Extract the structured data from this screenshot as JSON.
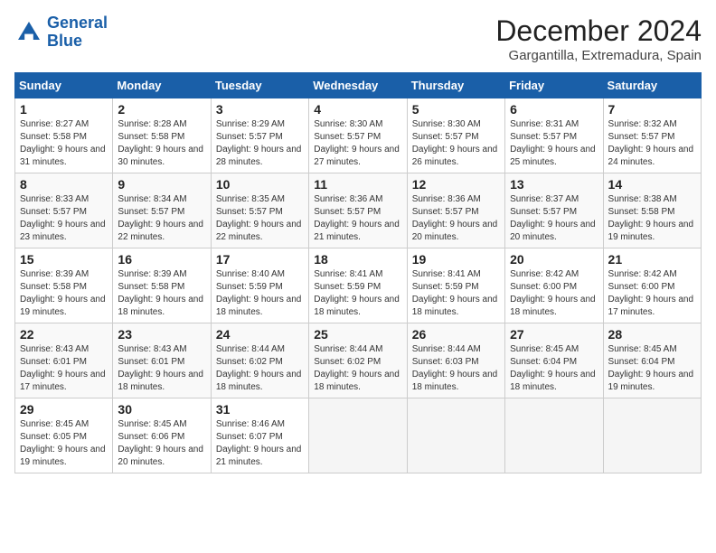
{
  "header": {
    "logo_line1": "General",
    "logo_line2": "Blue",
    "month_title": "December 2024",
    "location": "Gargantilla, Extremadura, Spain"
  },
  "days_of_week": [
    "Sunday",
    "Monday",
    "Tuesday",
    "Wednesday",
    "Thursday",
    "Friday",
    "Saturday"
  ],
  "weeks": [
    [
      {
        "day": "1",
        "sunrise": "Sunrise: 8:27 AM",
        "sunset": "Sunset: 5:58 PM",
        "daylight": "Daylight: 9 hours and 31 minutes."
      },
      {
        "day": "2",
        "sunrise": "Sunrise: 8:28 AM",
        "sunset": "Sunset: 5:58 PM",
        "daylight": "Daylight: 9 hours and 30 minutes."
      },
      {
        "day": "3",
        "sunrise": "Sunrise: 8:29 AM",
        "sunset": "Sunset: 5:57 PM",
        "daylight": "Daylight: 9 hours and 28 minutes."
      },
      {
        "day": "4",
        "sunrise": "Sunrise: 8:30 AM",
        "sunset": "Sunset: 5:57 PM",
        "daylight": "Daylight: 9 hours and 27 minutes."
      },
      {
        "day": "5",
        "sunrise": "Sunrise: 8:30 AM",
        "sunset": "Sunset: 5:57 PM",
        "daylight": "Daylight: 9 hours and 26 minutes."
      },
      {
        "day": "6",
        "sunrise": "Sunrise: 8:31 AM",
        "sunset": "Sunset: 5:57 PM",
        "daylight": "Daylight: 9 hours and 25 minutes."
      },
      {
        "day": "7",
        "sunrise": "Sunrise: 8:32 AM",
        "sunset": "Sunset: 5:57 PM",
        "daylight": "Daylight: 9 hours and 24 minutes."
      }
    ],
    [
      {
        "day": "8",
        "sunrise": "Sunrise: 8:33 AM",
        "sunset": "Sunset: 5:57 PM",
        "daylight": "Daylight: 9 hours and 23 minutes."
      },
      {
        "day": "9",
        "sunrise": "Sunrise: 8:34 AM",
        "sunset": "Sunset: 5:57 PM",
        "daylight": "Daylight: 9 hours and 22 minutes."
      },
      {
        "day": "10",
        "sunrise": "Sunrise: 8:35 AM",
        "sunset": "Sunset: 5:57 PM",
        "daylight": "Daylight: 9 hours and 22 minutes."
      },
      {
        "day": "11",
        "sunrise": "Sunrise: 8:36 AM",
        "sunset": "Sunset: 5:57 PM",
        "daylight": "Daylight: 9 hours and 21 minutes."
      },
      {
        "day": "12",
        "sunrise": "Sunrise: 8:36 AM",
        "sunset": "Sunset: 5:57 PM",
        "daylight": "Daylight: 9 hours and 20 minutes."
      },
      {
        "day": "13",
        "sunrise": "Sunrise: 8:37 AM",
        "sunset": "Sunset: 5:57 PM",
        "daylight": "Daylight: 9 hours and 20 minutes."
      },
      {
        "day": "14",
        "sunrise": "Sunrise: 8:38 AM",
        "sunset": "Sunset: 5:58 PM",
        "daylight": "Daylight: 9 hours and 19 minutes."
      }
    ],
    [
      {
        "day": "15",
        "sunrise": "Sunrise: 8:39 AM",
        "sunset": "Sunset: 5:58 PM",
        "daylight": "Daylight: 9 hours and 19 minutes."
      },
      {
        "day": "16",
        "sunrise": "Sunrise: 8:39 AM",
        "sunset": "Sunset: 5:58 PM",
        "daylight": "Daylight: 9 hours and 18 minutes."
      },
      {
        "day": "17",
        "sunrise": "Sunrise: 8:40 AM",
        "sunset": "Sunset: 5:59 PM",
        "daylight": "Daylight: 9 hours and 18 minutes."
      },
      {
        "day": "18",
        "sunrise": "Sunrise: 8:41 AM",
        "sunset": "Sunset: 5:59 PM",
        "daylight": "Daylight: 9 hours and 18 minutes."
      },
      {
        "day": "19",
        "sunrise": "Sunrise: 8:41 AM",
        "sunset": "Sunset: 5:59 PM",
        "daylight": "Daylight: 9 hours and 18 minutes."
      },
      {
        "day": "20",
        "sunrise": "Sunrise: 8:42 AM",
        "sunset": "Sunset: 6:00 PM",
        "daylight": "Daylight: 9 hours and 18 minutes."
      },
      {
        "day": "21",
        "sunrise": "Sunrise: 8:42 AM",
        "sunset": "Sunset: 6:00 PM",
        "daylight": "Daylight: 9 hours and 17 minutes."
      }
    ],
    [
      {
        "day": "22",
        "sunrise": "Sunrise: 8:43 AM",
        "sunset": "Sunset: 6:01 PM",
        "daylight": "Daylight: 9 hours and 17 minutes."
      },
      {
        "day": "23",
        "sunrise": "Sunrise: 8:43 AM",
        "sunset": "Sunset: 6:01 PM",
        "daylight": "Daylight: 9 hours and 18 minutes."
      },
      {
        "day": "24",
        "sunrise": "Sunrise: 8:44 AM",
        "sunset": "Sunset: 6:02 PM",
        "daylight": "Daylight: 9 hours and 18 minutes."
      },
      {
        "day": "25",
        "sunrise": "Sunrise: 8:44 AM",
        "sunset": "Sunset: 6:02 PM",
        "daylight": "Daylight: 9 hours and 18 minutes."
      },
      {
        "day": "26",
        "sunrise": "Sunrise: 8:44 AM",
        "sunset": "Sunset: 6:03 PM",
        "daylight": "Daylight: 9 hours and 18 minutes."
      },
      {
        "day": "27",
        "sunrise": "Sunrise: 8:45 AM",
        "sunset": "Sunset: 6:04 PM",
        "daylight": "Daylight: 9 hours and 18 minutes."
      },
      {
        "day": "28",
        "sunrise": "Sunrise: 8:45 AM",
        "sunset": "Sunset: 6:04 PM",
        "daylight": "Daylight: 9 hours and 19 minutes."
      }
    ],
    [
      {
        "day": "29",
        "sunrise": "Sunrise: 8:45 AM",
        "sunset": "Sunset: 6:05 PM",
        "daylight": "Daylight: 9 hours and 19 minutes."
      },
      {
        "day": "30",
        "sunrise": "Sunrise: 8:45 AM",
        "sunset": "Sunset: 6:06 PM",
        "daylight": "Daylight: 9 hours and 20 minutes."
      },
      {
        "day": "31",
        "sunrise": "Sunrise: 8:46 AM",
        "sunset": "Sunset: 6:07 PM",
        "daylight": "Daylight: 9 hours and 21 minutes."
      },
      null,
      null,
      null,
      null
    ]
  ]
}
